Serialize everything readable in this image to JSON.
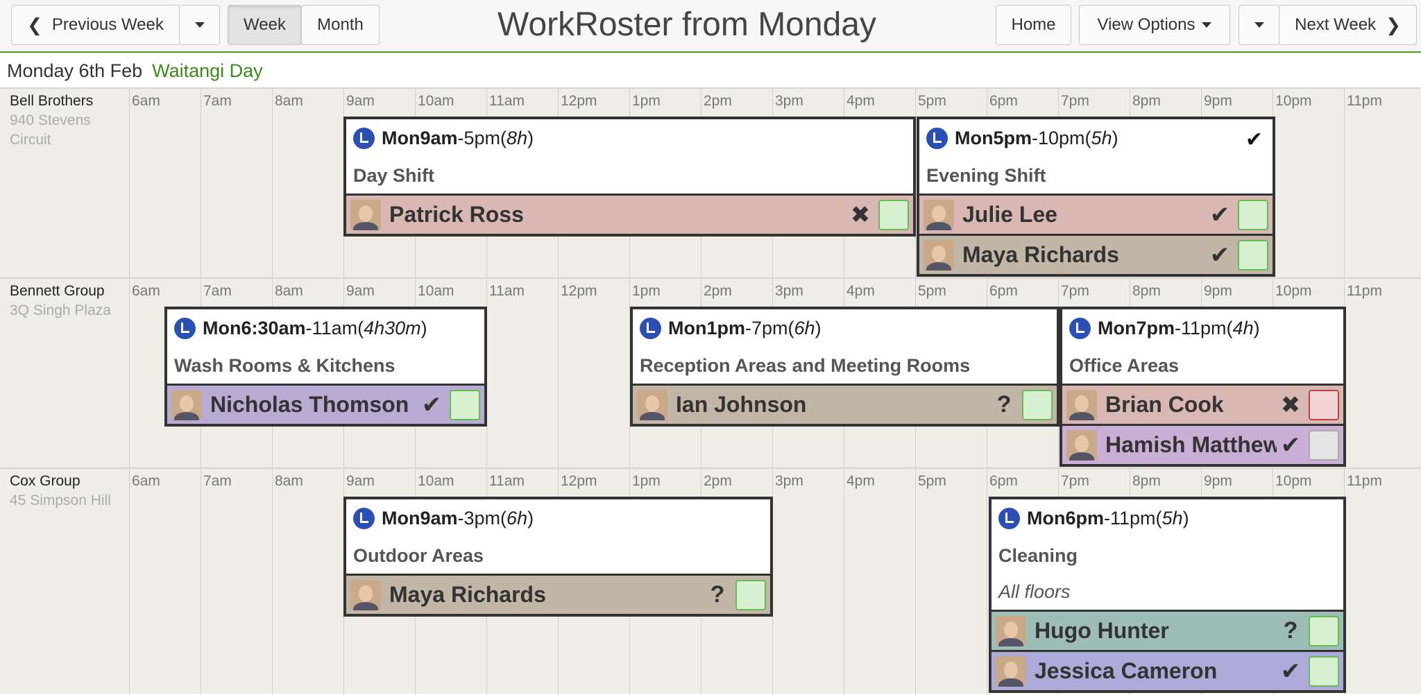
{
  "toolbar": {
    "prev_week": "Previous Week",
    "week": "Week",
    "month": "Month",
    "title": "WorkRoster from Monday",
    "home": "Home",
    "view_options": "View Options",
    "next_week": "Next Week"
  },
  "day": {
    "date": "Monday 6th Feb",
    "holiday": "Waitangi Day"
  },
  "hours": [
    "6am",
    "7am",
    "8am",
    "9am",
    "10am",
    "11am",
    "12pm",
    "1pm",
    "2pm",
    "3pm",
    "4pm",
    "5pm",
    "6pm",
    "7pm",
    "8pm",
    "9pm",
    "10pm",
    "11pm"
  ],
  "locations": [
    {
      "name": "Bell Brothers",
      "address": "940 Stevens Circuit",
      "shifts": [
        {
          "day": "Mon",
          "start": "9am",
          "end": "-5pm",
          "duration": "8h",
          "name": "Day Shift",
          "staff": [
            {
              "name": "Patrick Ross",
              "status": "✖",
              "color": "#d9b8b3",
              "box": "green"
            }
          ]
        },
        {
          "day": "Mon",
          "start": "5pm",
          "end": "-10pm",
          "duration": "5h",
          "name": "Evening Shift",
          "confirmed": "✔",
          "staff": [
            {
              "name": "Julie Lee",
              "status": "✔",
              "color": "#d9b8b3",
              "box": "green"
            },
            {
              "name": "Maya Richards",
              "status": "✔",
              "color": "#c2b6a6",
              "box": "green"
            }
          ]
        }
      ]
    },
    {
      "name": "Bennett Group",
      "address": "3Q Singh Plaza",
      "shifts": [
        {
          "day": "Mon",
          "start": "6:30am",
          "end": "-11am",
          "duration": "4h30m",
          "name": "Wash Rooms & Kitchens",
          "staff": [
            {
              "name": "Nicholas Thomson",
              "status": "✔",
              "color": "#b8abd4",
              "box": "green"
            }
          ]
        },
        {
          "day": "Mon",
          "start": "1pm",
          "end": "-7pm",
          "duration": "6h",
          "name": "Reception Areas and Meeting Rooms",
          "staff": [
            {
              "name": "Ian Johnson",
              "status": "?",
              "color": "#c2b6a6",
              "box": "green"
            }
          ]
        },
        {
          "day": "Mon",
          "start": "7pm",
          "end": "-11pm",
          "duration": "4h",
          "name": "Office Areas",
          "staff": [
            {
              "name": "Brian Cook",
              "status": "✖",
              "color": "#d9b8b3",
              "box": "red"
            },
            {
              "name": "Hamish Matthews",
              "status": "✔",
              "color": "#c9afd6",
              "box": "grey"
            }
          ]
        }
      ]
    },
    {
      "name": "Cox Group",
      "address": "45 Simpson Hill",
      "shifts": [
        {
          "day": "Mon",
          "start": "9am",
          "end": "-3pm",
          "duration": "6h",
          "name": "Outdoor Areas",
          "staff": [
            {
              "name": "Maya Richards",
              "status": "?",
              "color": "#c2b6a6",
              "box": "green"
            }
          ]
        },
        {
          "day": "Mon",
          "start": "6pm",
          "end": "-11pm",
          "duration": "5h",
          "name": "Cleaning",
          "note": "All floors",
          "staff": [
            {
              "name": "Hugo Hunter",
              "status": "?",
              "color": "#9dbdb7",
              "box": "green"
            },
            {
              "name": "Jessica Cameron",
              "status": "✔",
              "color": "#abaad8",
              "box": "green"
            }
          ]
        }
      ]
    }
  ]
}
